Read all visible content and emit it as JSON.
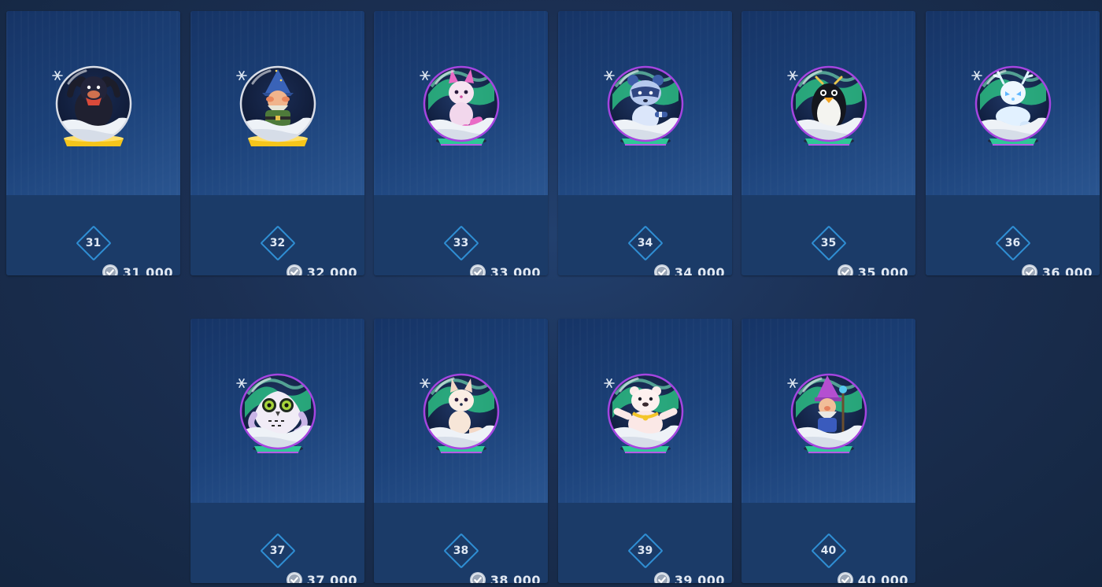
{
  "colors": {
    "page_background": "#1b2f52",
    "card": "#1b3b68",
    "level_badge_border": "#2f8ed3",
    "text": "#e1e8f2",
    "gold_base": "#f5c51b",
    "aurora_green": "#2fd08a",
    "aurora_purple": "#a545e0"
  },
  "items": [
    {
      "level": "31",
      "price": "31 000",
      "character": "black-bear",
      "globe_style": "gold"
    },
    {
      "level": "32",
      "price": "32 000",
      "character": "gnome-wizard",
      "globe_style": "gold"
    },
    {
      "level": "33",
      "price": "33 000",
      "character": "pink-fox",
      "globe_style": "aurora"
    },
    {
      "level": "34",
      "price": "34 000",
      "character": "raccoon",
      "globe_style": "aurora"
    },
    {
      "level": "35",
      "price": "35 000",
      "character": "penguin",
      "globe_style": "aurora"
    },
    {
      "level": "36",
      "price": "36 000",
      "character": "white-reindeer",
      "globe_style": "aurora"
    },
    {
      "level": "37",
      "price": "37 000",
      "character": "snowy-owl",
      "globe_style": "aurora"
    },
    {
      "level": "38",
      "price": "38 000",
      "character": "arctic-fox",
      "globe_style": "aurora"
    },
    {
      "level": "39",
      "price": "39 000",
      "character": "polar-bear",
      "globe_style": "aurora"
    },
    {
      "level": "40",
      "price": "40 000",
      "character": "gnome-staff",
      "globe_style": "aurora"
    }
  ]
}
